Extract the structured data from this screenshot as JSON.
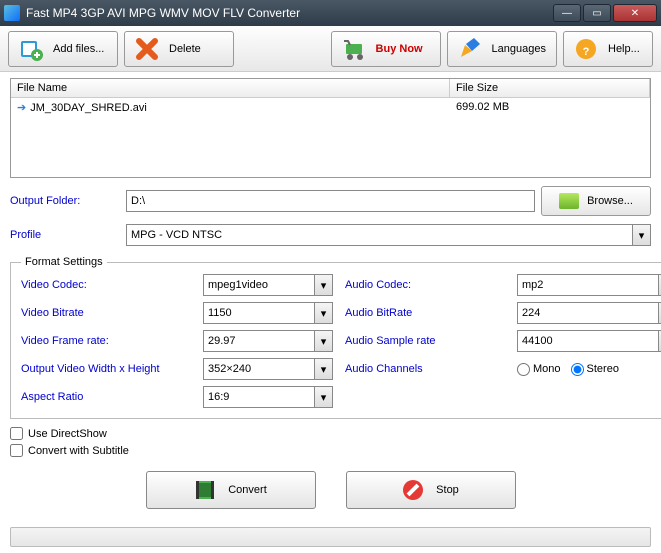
{
  "window": {
    "title": "Fast MP4 3GP AVI MPG WMV MOV FLV Converter"
  },
  "toolbar": {
    "add_files": "Add files...",
    "delete": "Delete",
    "buy_now": "Buy Now",
    "languages": "Languages",
    "help": "Help..."
  },
  "filelist": {
    "col_name": "File Name",
    "col_size": "File Size",
    "rows": [
      {
        "name": "JM_30DAY_SHRED.avi",
        "size": "699.02 MB"
      }
    ]
  },
  "output": {
    "folder_label": "Output Folder:",
    "folder_value": "D:\\",
    "browse": "Browse...",
    "profile_label": "Profile",
    "profile_value": "MPG - VCD NTSC"
  },
  "format": {
    "legend": "Format Settings",
    "video_codec_l": "Video Codec:",
    "video_codec_v": "mpeg1video",
    "audio_codec_l": "Audio Codec:",
    "audio_codec_v": "mp2",
    "video_bitrate_l": "Video Bitrate",
    "video_bitrate_v": "1150",
    "audio_bitrate_l": "Audio BitRate",
    "audio_bitrate_v": "224",
    "video_fps_l": "Video Frame rate:",
    "video_fps_v": "29.97",
    "audio_sample_l": "Audio Sample rate",
    "audio_sample_v": "44100",
    "video_wh_l": "Output Video Width x Height",
    "video_wh_v": "352×240",
    "audio_ch_l": "Audio Channels",
    "mono": "Mono",
    "stereo": "Stereo",
    "aspect_l": "Aspect Ratio",
    "aspect_v": "16:9"
  },
  "checks": {
    "directshow": "Use DirectShow",
    "subtitle": "Convert with Subtitle"
  },
  "actions": {
    "convert": "Convert",
    "stop": "Stop"
  }
}
